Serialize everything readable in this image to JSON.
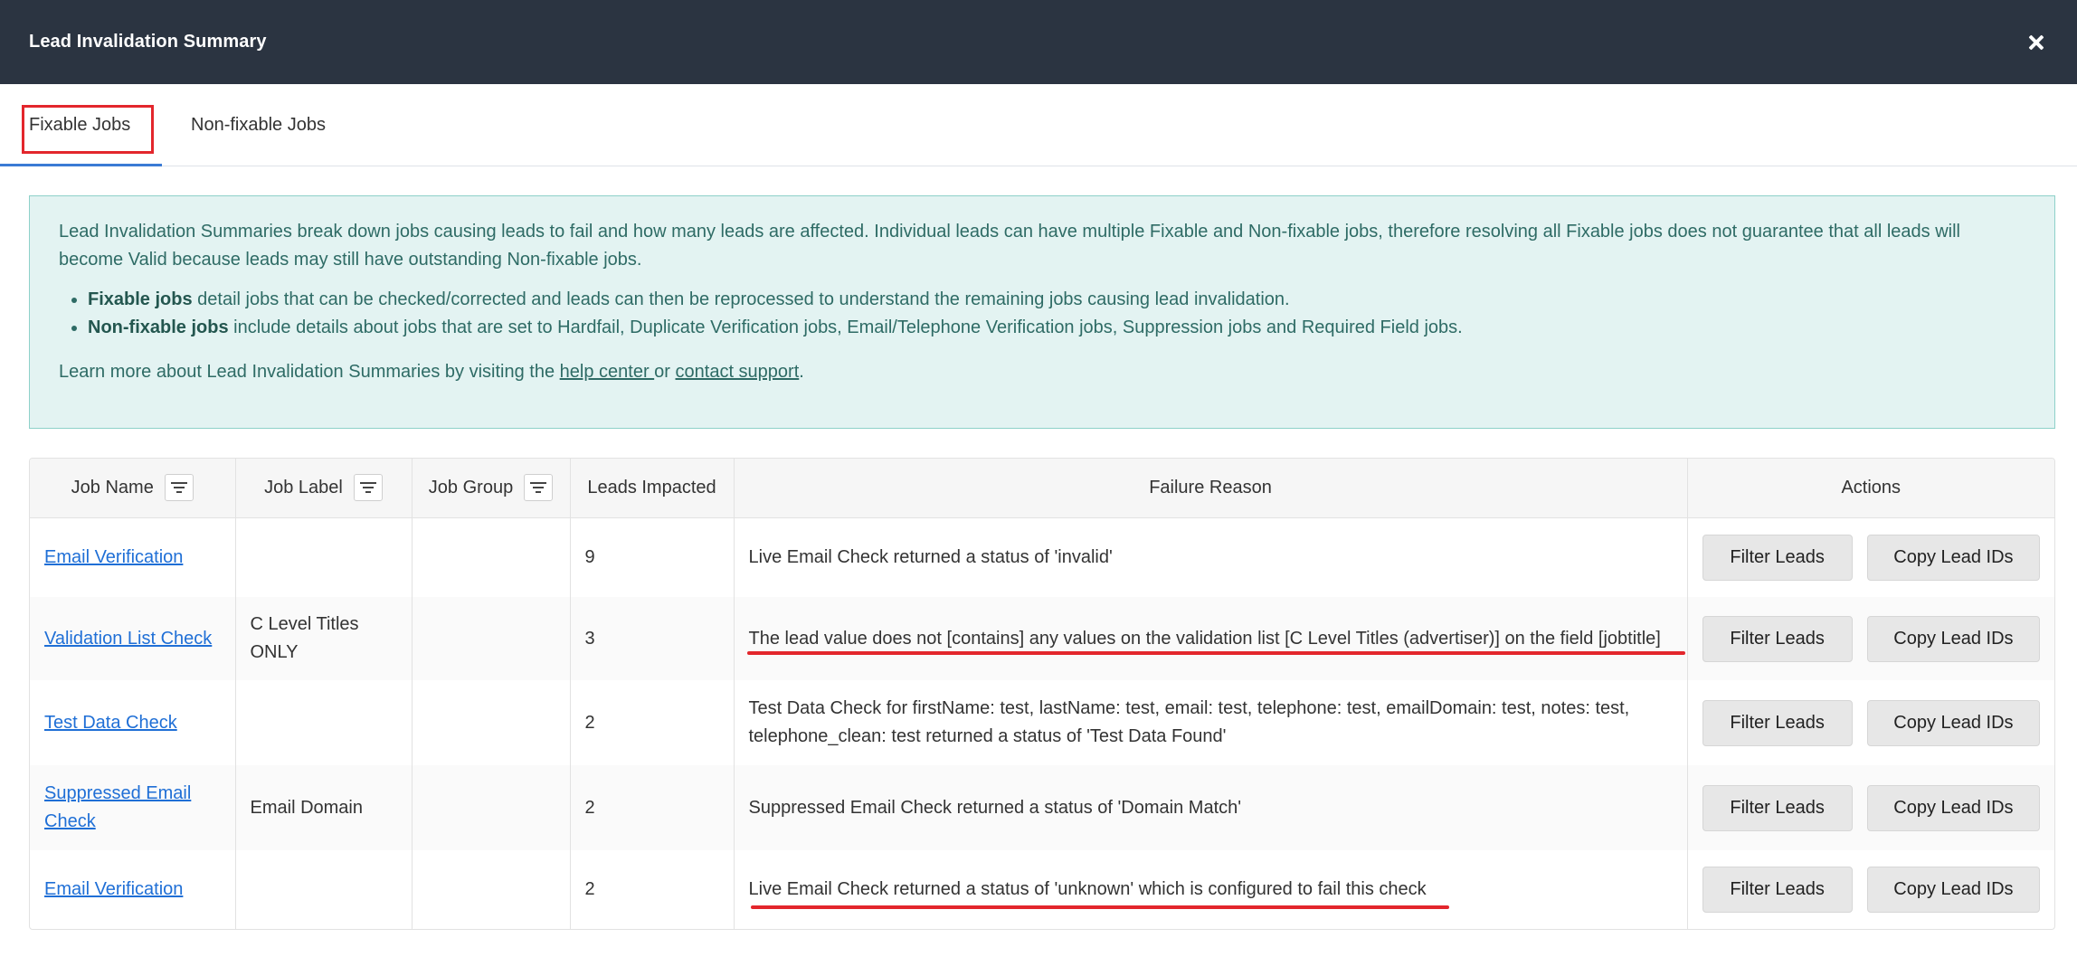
{
  "modal": {
    "title": "Lead Invalidation Summary"
  },
  "tabs": [
    {
      "label": "Fixable Jobs",
      "active": true
    },
    {
      "label": "Non-fixable Jobs",
      "active": false
    }
  ],
  "info": {
    "intro": "Lead Invalidation Summaries break down jobs causing leads to fail and how many leads are affected. Individual leads can have multiple Fixable and Non-fixable jobs, therefore resolving all Fixable jobs does not guarantee that all leads will become Valid because leads may still have outstanding Non-fixable jobs.",
    "bullet1_bold": "Fixable jobs",
    "bullet1_text": " detail jobs that can be checked/corrected and leads can then be reprocessed to understand the remaining jobs causing lead invalidation.",
    "bullet2_bold": "Non-fixable jobs",
    "bullet2_text": " include details about jobs that are set to Hardfail, Duplicate Verification jobs, Email/Telephone Verification jobs, Suppression jobs and Required Field jobs.",
    "learn_prefix": "Learn more about Lead Invalidation Summaries by visiting the ",
    "help_link": "help center ",
    "learn_or": "or ",
    "support_link": "contact support",
    "learn_suffix": "."
  },
  "table": {
    "headers": {
      "job_name": "Job Name",
      "job_label": "Job Label",
      "job_group": "Job Group",
      "leads_impacted": "Leads Impacted",
      "failure_reason": "Failure Reason",
      "actions": "Actions"
    },
    "rows": [
      {
        "job_name": "Email Verification",
        "job_label": "",
        "job_group": "",
        "leads": "9",
        "reason": "Live Email Check returned a status of 'invalid'"
      },
      {
        "job_name": "Validation List Check",
        "job_label": "C Level Titles ONLY",
        "job_group": "",
        "leads": "3",
        "reason": "The lead value does not [contains] any values on the validation list [C Level Titles (advertiser)] on the field [jobtitle]"
      },
      {
        "job_name": "Test Data Check",
        "job_label": "",
        "job_group": "",
        "leads": "2",
        "reason": "Test Data Check for firstName: test, lastName: test, email: test, telephone: test, emailDomain: test, notes: test, telephone_clean: test returned a status of 'Test Data Found'"
      },
      {
        "job_name": "Suppressed Email Check",
        "job_label": "Email Domain",
        "job_group": "",
        "leads": "2",
        "reason": "Suppressed Email Check returned a status of 'Domain Match'"
      },
      {
        "job_name": "Email Verification",
        "job_label": "",
        "job_group": "",
        "leads": "2",
        "reason": "Live Email Check returned a status of 'unknown' which is configured to fail this check"
      }
    ],
    "actions": {
      "filter_label": "Filter Leads",
      "copy_label": "Copy Lead IDs"
    }
  },
  "colors": {
    "header_bg": "#2b3441",
    "accent_tab": "#3a7bd5",
    "info_bg": "#e3f3f2",
    "link": "#1f6fd6",
    "annotation_red": "#e3262c"
  }
}
